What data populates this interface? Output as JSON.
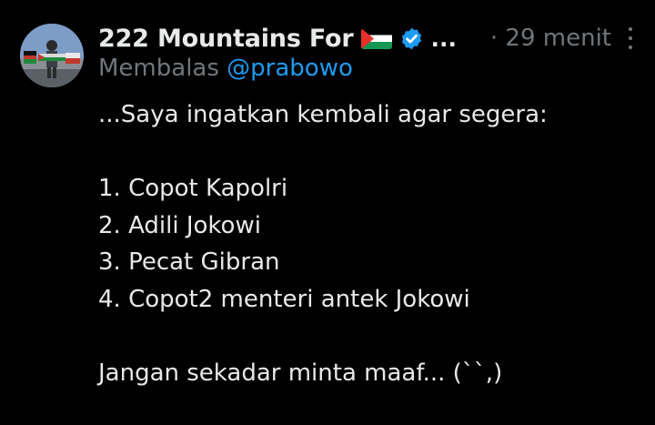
{
  "tweet": {
    "display_name": "222 Mountains For",
    "flag_icon": "palestine-flag-icon",
    "verified_icon": "verified-badge-icon",
    "name_overflow": "...",
    "time": "· 29 menit",
    "more_icon": "more-vertical-icon",
    "reply_prefix": "Membalas",
    "reply_handle": "@prabowo",
    "lines": [
      "...Saya ingatkan kembali agar segera:",
      "",
      "1. Copot Kapolri",
      "2. Adili Jokowi",
      "3. Pecat Gibran",
      "4. Copot2 menteri antek Jokowi",
      "",
      "Jangan sekadar minta maaf... (``,)"
    ]
  },
  "colors": {
    "background": "#000000",
    "text": "#e7e9ea",
    "secondary": "#71767b",
    "accent": "#1d9bf0"
  }
}
